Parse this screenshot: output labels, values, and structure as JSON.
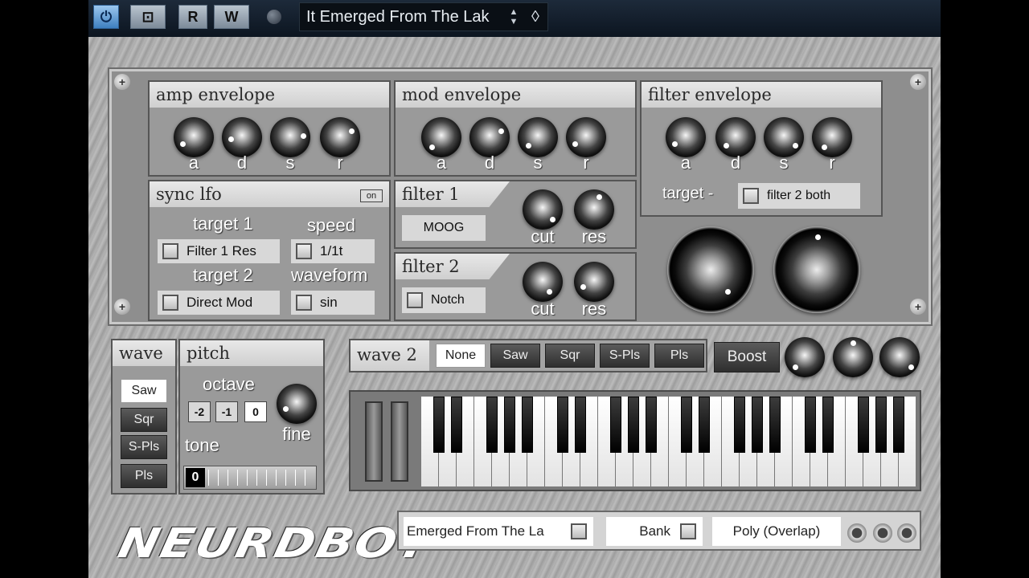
{
  "host": {
    "power_label": "⏻",
    "monitor_label": "⊡",
    "read_label": "R",
    "write_label": "W",
    "preset_name": "It Emerged From The Lak",
    "spin_up": "▲",
    "spin_down": "▼",
    "menu_icon": "◊"
  },
  "amp_envelope": {
    "title": "amp envelope",
    "labels": [
      "a",
      "d",
      "s",
      "r"
    ]
  },
  "mod_envelope": {
    "title": "mod envelope",
    "labels": [
      "a",
      "d",
      "s",
      "r"
    ]
  },
  "filter_envelope": {
    "title": "filter envelope",
    "labels": [
      "a",
      "d",
      "s",
      "r"
    ],
    "target_label": "target -",
    "target_value": "filter 2 both"
  },
  "sync_lfo": {
    "title": "sync lfo",
    "on_label": "on",
    "target1_label": "target 1",
    "target1_value": "Filter 1 Res",
    "speed_label": "speed",
    "speed_value": "1/1t",
    "target2_label": "target 2",
    "target2_value": "Direct Mod",
    "waveform_label": "waveform",
    "waveform_value": "sin"
  },
  "filter1": {
    "title": "filter 1",
    "type": "MOOG",
    "cut_label": "cut",
    "res_label": "res"
  },
  "filter2": {
    "title": "filter 2",
    "type": "Notch",
    "cut_label": "cut",
    "res_label": "res"
  },
  "wave": {
    "title": "wave",
    "options": [
      "Saw",
      "Sqr",
      "S-Pls",
      "Pls"
    ],
    "selected": "Saw"
  },
  "pitch": {
    "title": "pitch",
    "octave_label": "octave",
    "octave_options": [
      "-2",
      "-1",
      "0"
    ],
    "fine_label": "fine",
    "tone_label": "tone",
    "tone_value": "0"
  },
  "wave2": {
    "title": "wave 2",
    "options": [
      "None",
      "Saw",
      "Sqr",
      "S-Pls",
      "Pls"
    ],
    "selected": "None"
  },
  "boost_label": "Boost",
  "bottom": {
    "logo": "NEURDBOT",
    "preset_field": "Emerged From The La",
    "bank_label": "Bank",
    "mode_label": "Poly (Overlap)"
  }
}
